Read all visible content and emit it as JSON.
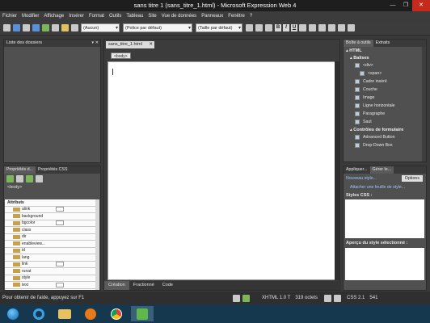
{
  "window": {
    "title": "sans titre 1 (sans_titre_1.html) - Microsoft Expression Web 4"
  },
  "menu": [
    "Fichier",
    "Modifier",
    "Affichage",
    "Insérer",
    "Format",
    "Outils",
    "Tableau",
    "Site",
    "Vue de données",
    "Panneaux",
    "Fenêtre",
    "?"
  ],
  "toolbar": {
    "style_select": "(Aucun)",
    "font_select": "(Police par défaut)",
    "size_select": "(Taille par défaut)",
    "bold": "B",
    "italic": "I",
    "underline": "U"
  },
  "folder_panel": {
    "title": "Liste des dossiers"
  },
  "doc": {
    "tab": "sans_titre_1.html",
    "body_tag": "<body>",
    "view_tabs": [
      "Création",
      "Fractionné",
      "Code"
    ]
  },
  "props_panel": {
    "tabs": [
      "Propriétés d...",
      "Propriétés CSS"
    ],
    "tag": "<body>",
    "section": "Attributs",
    "rows": [
      "alink",
      "background",
      "bgcolor",
      "class",
      "dir",
      "enableview...",
      "id",
      "lang",
      "link",
      "runat",
      "style",
      "text"
    ]
  },
  "toolbox": {
    "tabs": [
      "Boîte à outils",
      "Extraits"
    ],
    "root": "HTML",
    "cat1": "Balises",
    "tags": [
      "<div>",
      "<span>",
      "Cadre inséré",
      "Couche",
      "Image",
      "Ligne horizontale",
      "Paragraphe",
      "Saut"
    ],
    "cat2": "Contrôles de formulaire",
    "forms": [
      "Advanced Button",
      "Drop-Down Box"
    ]
  },
  "styles_panel": {
    "tabs": [
      "Appliquer...",
      "Gérer le..."
    ],
    "new_style": "Nouveau style...",
    "options": "Options",
    "attach": "Attacher une feuille de style...",
    "styles_css": "Styles CSS :",
    "preview": "Aperçu du style sélectionné :"
  },
  "status": {
    "help": "Pour obtenir de l'aide, appuyez sur F1",
    "doctype": "XHTML 1.0 T",
    "size": "319 octets",
    "css": "CSS 2.1",
    "dims": "541"
  }
}
